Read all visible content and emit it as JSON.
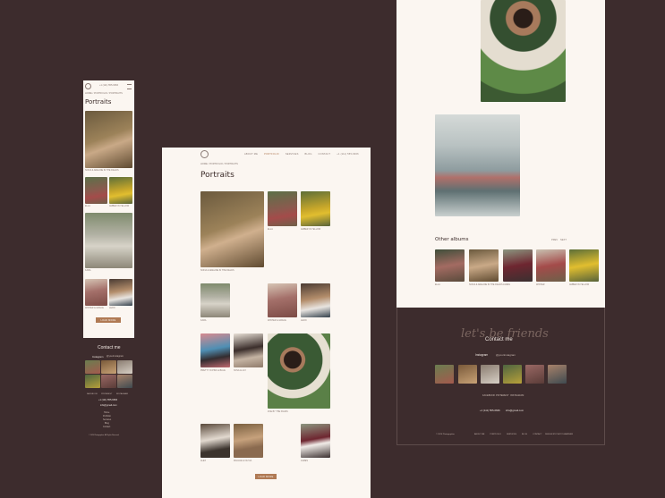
{
  "mobile": {
    "phone": "+1 (111) 555-6666",
    "breadcrumb": "HOME / PORTFOLIO / PORTRAITS",
    "title": "Portraits",
    "captions": [
      "SOFIA & ADELINE IN THE FIELDS",
      "ELLA",
      "AMBER IN YELLOW",
      "KARA",
      "WINTER & GRACE",
      "LEON"
    ],
    "more_label": "LOAD MORE",
    "contact_title": "Contact me",
    "instagram_label": "Instagram",
    "instagram_handle": "@yourinstagram",
    "social": [
      "FACEBOOK",
      "PINTEREST",
      "INSTAGRAM"
    ],
    "phone_footer": "+1 (111) 555-6666",
    "email": "info@gmail.com",
    "menu": [
      "Home",
      "Portfolio",
      "Services",
      "Blog",
      "Contact"
    ],
    "copyright": "© 2024 Photographer. All Rights Reserved"
  },
  "desktop": {
    "nav": [
      "ABOUT ME",
      "PORTFOLIO",
      "SERVICES",
      "BLOG",
      "CONTACT",
      "+1 (111) 555-6666"
    ],
    "breadcrumb": "HOME / PORTFOLIO / PORTRAITS",
    "title": "Portraits",
    "captions": {
      "c1": "SOFIA & ADELINE IN THE FIELDS",
      "c2": "ELLA",
      "c3": "AMBER IN YELLOW",
      "c4": "KARA",
      "c5": "WINTER & GRACE",
      "c6": "LEON",
      "c7": "PRETTY IN PINK & BLUE",
      "c8": "NOVA & LILY",
      "c9": "ZOE BY THE PALMS",
      "c10": "ALEX",
      "c11": "MAGGIE & OLIVIA",
      "c12": "JAMES"
    },
    "load_more": "LOAD MORE"
  },
  "right": {
    "other_albums": "Other albums",
    "nav_prev": "PREV",
    "nav_next": "NEXT",
    "album_captions": [
      "ELLA",
      "SOFIA & ADELINE IN THE FIELDS",
      "JAMES",
      "WINTER",
      "AMBER IN YELLOW"
    ],
    "script_text": "let's be friends",
    "contact_title": "Contact me",
    "instagram_label": "Instagram",
    "instagram_handle": "@yourinstagram",
    "social": [
      "FACEBOOK",
      "PINTEREST",
      "INSTAGRAM"
    ],
    "phone": "+1 (111) 555-6666",
    "email": "info@gmail.com",
    "copyright": "© 2024 Photographer",
    "footer_nav": [
      "ABOUT ME",
      "PORTFOLIO",
      "SERVICES",
      "BLOG",
      "CONTACT"
    ],
    "credit": "DESIGN BY PHOTOGRAPHER"
  },
  "colors": {
    "bg": "#3d2c2d",
    "paper": "#fbf6f1",
    "accent": "#b07a54"
  }
}
